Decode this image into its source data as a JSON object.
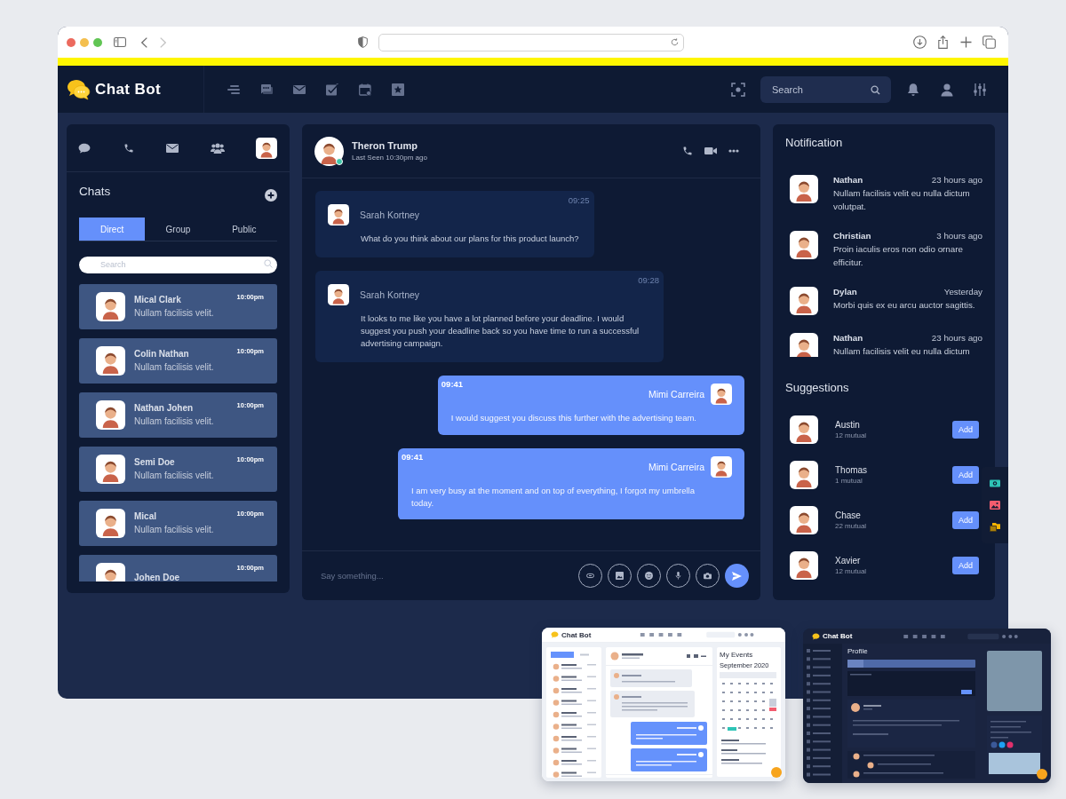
{
  "browser": {
    "nav": [
      {
        "kind": "back",
        "disabled": false
      },
      {
        "kind": "forward",
        "disabled": true
      }
    ]
  },
  "app": {
    "logo": "Chat Bot",
    "search": {
      "placeholder": "Search"
    }
  },
  "sidebar": {
    "title": "Chats",
    "tabs": [
      {
        "label": "Direct",
        "selected": true
      },
      {
        "label": "Group",
        "selected": false
      },
      {
        "label": "Public",
        "selected": false
      }
    ],
    "search": {
      "placeholder": "Search"
    },
    "chats": [
      {
        "name": "Mical Clark",
        "message": "Nullam facilisis velit.",
        "time": "10:00pm"
      },
      {
        "name": "Colin Nathan",
        "message": "Nullam facilisis velit.",
        "time": "10:00pm"
      },
      {
        "name": "Nathan Johen",
        "message": "Nullam facilisis velit.",
        "time": "10:00pm"
      },
      {
        "name": "Semi Doe",
        "message": "Nullam facilisis velit.",
        "time": "10:00pm"
      },
      {
        "name": "Mical",
        "message": "Nullam facilisis velit.",
        "time": "10:00pm"
      },
      {
        "name": "Johen Doe",
        "time": "10:00pm"
      }
    ]
  },
  "conversation": {
    "contact": {
      "name": "Theron Trump",
      "status": "Last Seen 10:30pm ago",
      "online": true
    },
    "messages": [
      {
        "kind": "incoming",
        "time": "09:25",
        "sender": "Sarah Kortney",
        "text": "What do you think about our plans for this product launch?"
      },
      {
        "kind": "incoming",
        "time": "09:28",
        "sender": "Sarah Kortney",
        "text": "It looks to me like you have a lot planned before your deadline. I would suggest you push your deadline back so you have time to run a successful advertising campaign."
      },
      {
        "kind": "outgoing",
        "time": "09:41",
        "sender": "Mimi Carreira",
        "text": "I would suggest you discuss this further with the advertising team."
      },
      {
        "kind": "outgoing",
        "time": "09:41",
        "sender": "Mimi Carreira",
        "text": "I am very busy at the moment and on top of everything, I forgot my umbrella today."
      }
    ],
    "composer": {
      "placeholder": "Say something..."
    }
  },
  "notifications": {
    "title": "Notification",
    "items": [
      {
        "name": "Nathan",
        "time": "23 hours ago",
        "message": "Nullam facilisis velit eu nulla dictum volutpat."
      },
      {
        "name": "Christian",
        "time": "3 hours ago",
        "message": "Proin iaculis eros non odio ornare efficitur."
      },
      {
        "name": "Dylan",
        "time": "Yesterday",
        "message": "Morbi quis ex eu arcu auctor sagittis."
      },
      {
        "name": "Nathan",
        "time": "23 hours ago",
        "message": "Nullam facilisis velit eu nulla dictum"
      }
    ]
  },
  "suggestions": {
    "title": "Suggestions",
    "items": [
      {
        "name": "Austin",
        "mutual": "12 mutual",
        "button": "Add"
      },
      {
        "name": "Thomas",
        "mutual": "1 mutual",
        "button": "Add"
      },
      {
        "name": "Chase",
        "mutual": "22 mutual",
        "button": "Add"
      },
      {
        "name": "Xavier",
        "mutual": "12 mutual",
        "button": "Add"
      }
    ]
  },
  "previews": [
    {
      "kind": "light",
      "logo": "Chat Bot",
      "title": "My Events",
      "subtitle": "September 2020"
    },
    {
      "kind": "dark",
      "logo": "Chat Bot",
      "title": "Profile"
    }
  ]
}
